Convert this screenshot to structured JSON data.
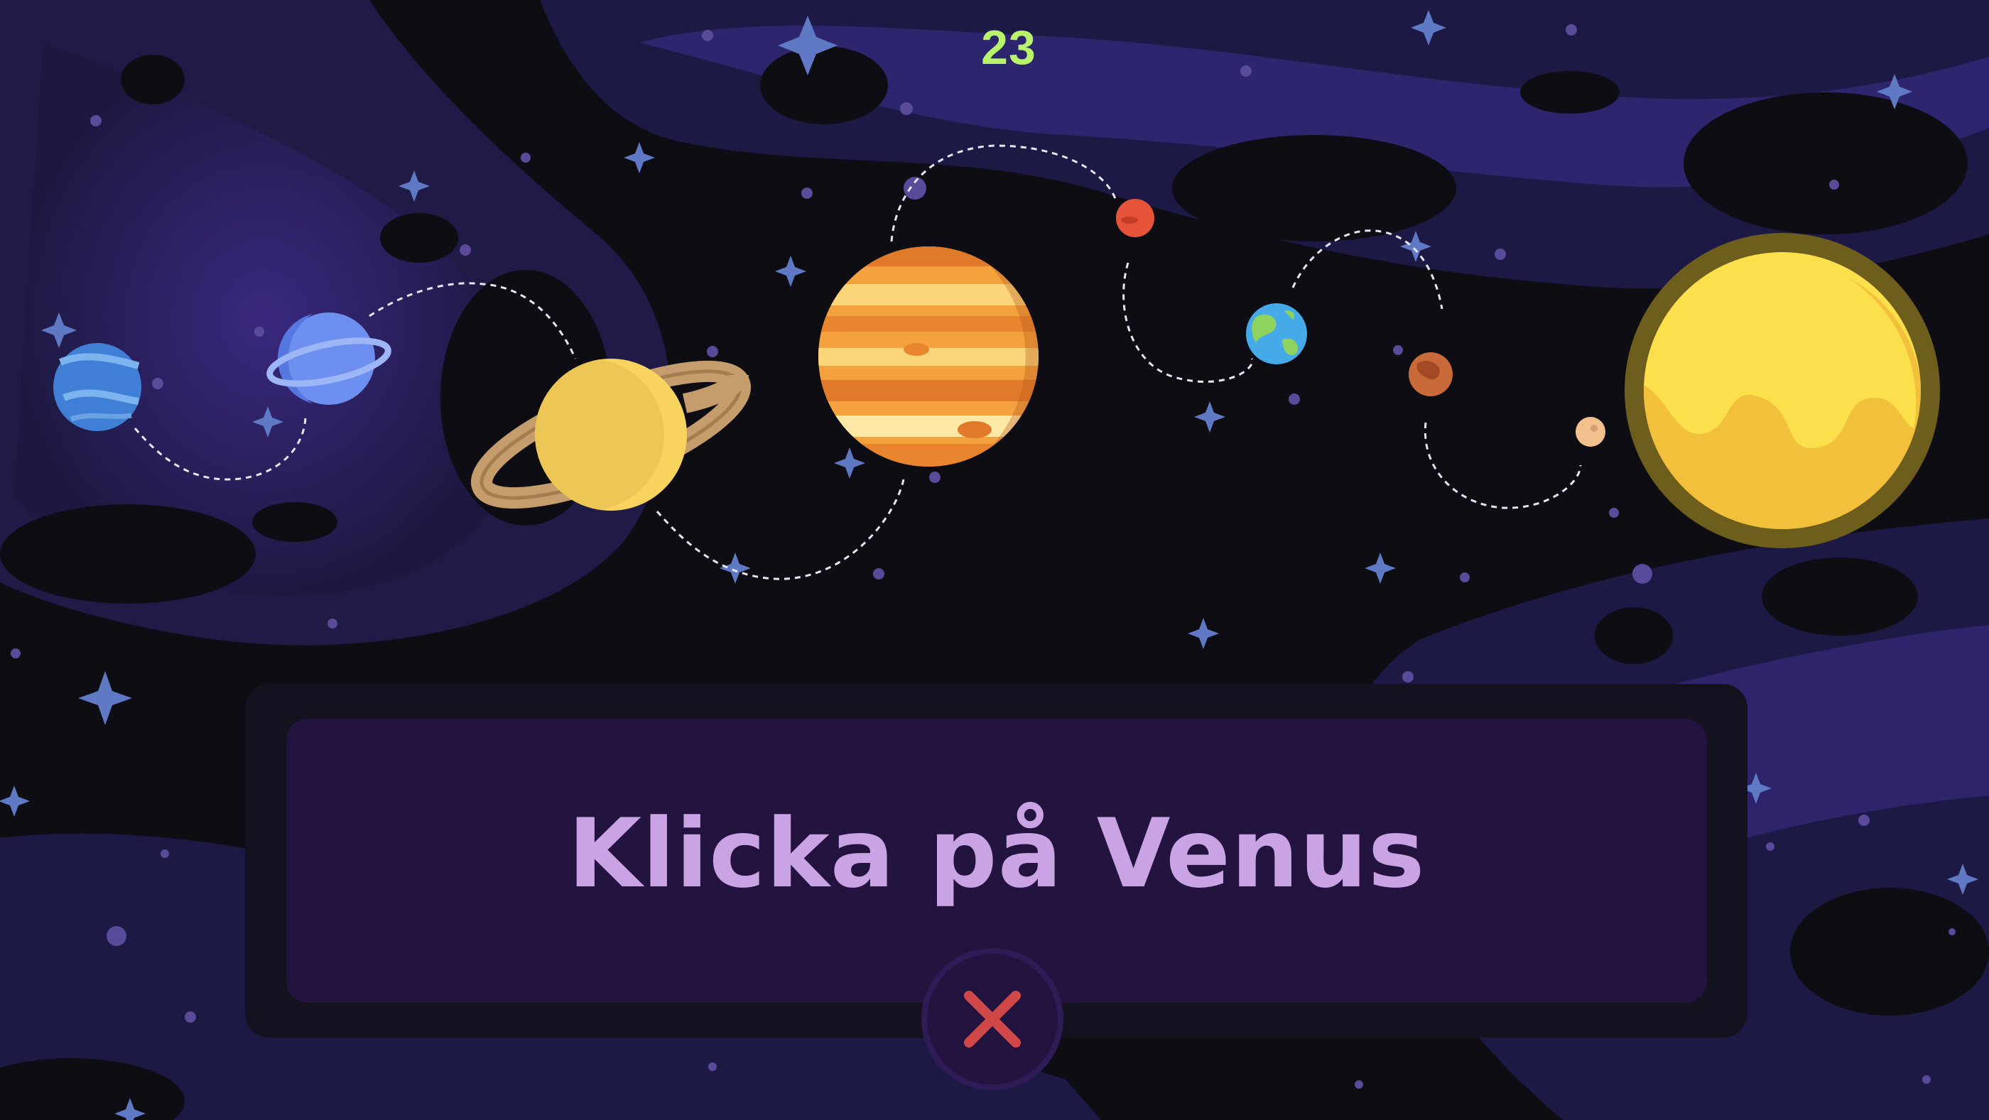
{
  "game": {
    "score": "23",
    "prompt": "Klicka på Venus",
    "close_icon": "close-x-icon"
  },
  "planets": [
    "neptune",
    "uranus",
    "saturn",
    "jupiter",
    "mars",
    "earth",
    "venus",
    "mercury",
    "sun"
  ],
  "colors": {
    "background": "#0e0d14",
    "nebula": "#2a1f5e",
    "panel_outer": "#13121e",
    "panel_inner": "#22133f",
    "prompt_text": "#c9a3e4",
    "score_text": "#b9f36b",
    "close_x": "#d04848"
  }
}
